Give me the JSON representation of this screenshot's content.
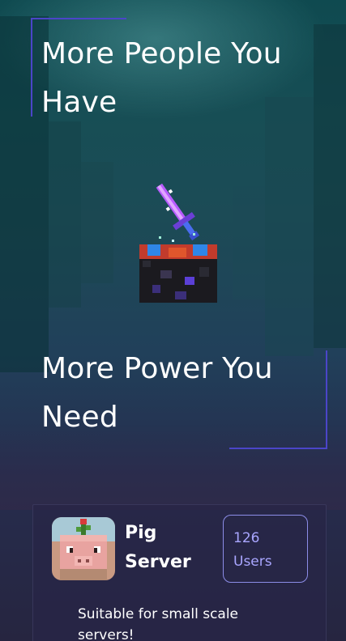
{
  "hero": {
    "heading_top": "More People You Have",
    "heading_bottom": "More Power You Need",
    "artwork_icon": "enchanted-sword-on-ore-block"
  },
  "server_card": {
    "icon": "pig-avatar",
    "title": "Pig Server",
    "users_count": "126",
    "users_label": "Users",
    "description": "Suitable for small scale servers!"
  },
  "colors": {
    "frame_accent": "#4b45c9",
    "badge_border": "#8c8de8",
    "badge_text": "#a9a6ff"
  }
}
